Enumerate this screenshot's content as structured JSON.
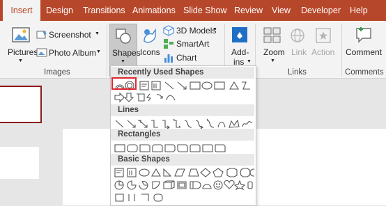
{
  "tabs": [
    {
      "label": "Insert",
      "active": true
    },
    {
      "label": "Design"
    },
    {
      "label": "Transitions"
    },
    {
      "label": "Animations"
    },
    {
      "label": "Slide Show"
    },
    {
      "label": "Review"
    },
    {
      "label": "View"
    },
    {
      "label": "Developer"
    },
    {
      "label": "Help"
    }
  ],
  "ribbon": {
    "pictures": "Pictures",
    "screenshot": "Screenshot",
    "photo_album": "Photo Album",
    "images_group": "Images",
    "shapes": "Shapes",
    "icons": "Icons",
    "models_3d": "3D Models",
    "smartart": "SmartArt",
    "chart": "Chart",
    "addins_line1": "Add-",
    "addins_line2": "ins",
    "zoom": "Zoom",
    "link": "Link",
    "action": "Action",
    "links_group": "Links",
    "comment": "Comment",
    "comments_group": "Comments"
  },
  "shapes_menu": {
    "recently_used": "Recently Used Shapes",
    "lines": "Lines",
    "rectangles": "Rectangles",
    "basic_shapes": "Basic Shapes"
  },
  "colors": {
    "accent": "#b7472a",
    "highlight": "#e0262d"
  },
  "icons": [
    "pictures-icon",
    "screenshot-icon",
    "photo-album-icon",
    "shapes-icon",
    "icons-icon",
    "3d-models-icon",
    "smartart-icon",
    "chart-icon",
    "addins-icon",
    "zoom-icon",
    "link-icon",
    "action-icon",
    "comment-icon"
  ]
}
